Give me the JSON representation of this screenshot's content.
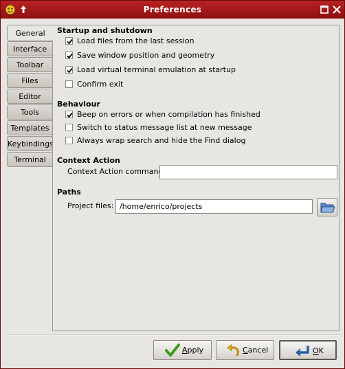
{
  "window": {
    "title": "Preferences"
  },
  "tabs": [
    {
      "label": "General",
      "active": true
    },
    {
      "label": "Interface",
      "active": false
    },
    {
      "label": "Toolbar",
      "active": false
    },
    {
      "label": "Files",
      "active": false
    },
    {
      "label": "Editor",
      "active": false
    },
    {
      "label": "Tools",
      "active": false
    },
    {
      "label": "Templates",
      "active": false
    },
    {
      "label": "Keybindings",
      "active": false
    },
    {
      "label": "Terminal",
      "active": false
    }
  ],
  "startup": {
    "title": "Startup and shutdown",
    "options": [
      {
        "label": "Load files from the last session",
        "checked": true
      },
      {
        "label": "Save window position and geometry",
        "checked": true
      },
      {
        "label": "Load virtual terminal emulation at startup",
        "checked": true
      },
      {
        "label": "Confirm exit",
        "checked": false
      }
    ]
  },
  "behaviour": {
    "title": "Behaviour",
    "options": [
      {
        "label": "Beep on errors or when compilation has finished",
        "checked": true
      },
      {
        "label": "Switch to status message list at new message",
        "checked": false
      },
      {
        "label": "Always wrap search and hide the Find dialog",
        "checked": false
      }
    ]
  },
  "context_action": {
    "title": "Context Action",
    "command_label": "Context Action command:",
    "command_value": ""
  },
  "paths": {
    "title": "Paths",
    "project_files_label": "Project files:",
    "project_files_value": "/home/enrico/projects"
  },
  "buttons": {
    "apply": {
      "underlined": "A",
      "rest": "pply"
    },
    "cancel": {
      "underlined": "C",
      "rest": "ancel"
    },
    "ok": {
      "underlined": "O",
      "rest": "K"
    }
  },
  "colors": {
    "titlebar": "#a31a1a",
    "accent_blue": "#2d5ea8",
    "check_green": "#3e9a1e"
  },
  "icons": {
    "app": "app-menu-icon",
    "pin": "pin-icon",
    "maximize": "maximize-icon",
    "close": "close-icon",
    "folder": "open-folder-icon",
    "apply": "checkmark-icon",
    "cancel": "undo-arrow-icon",
    "ok": "return-arrow-icon"
  }
}
